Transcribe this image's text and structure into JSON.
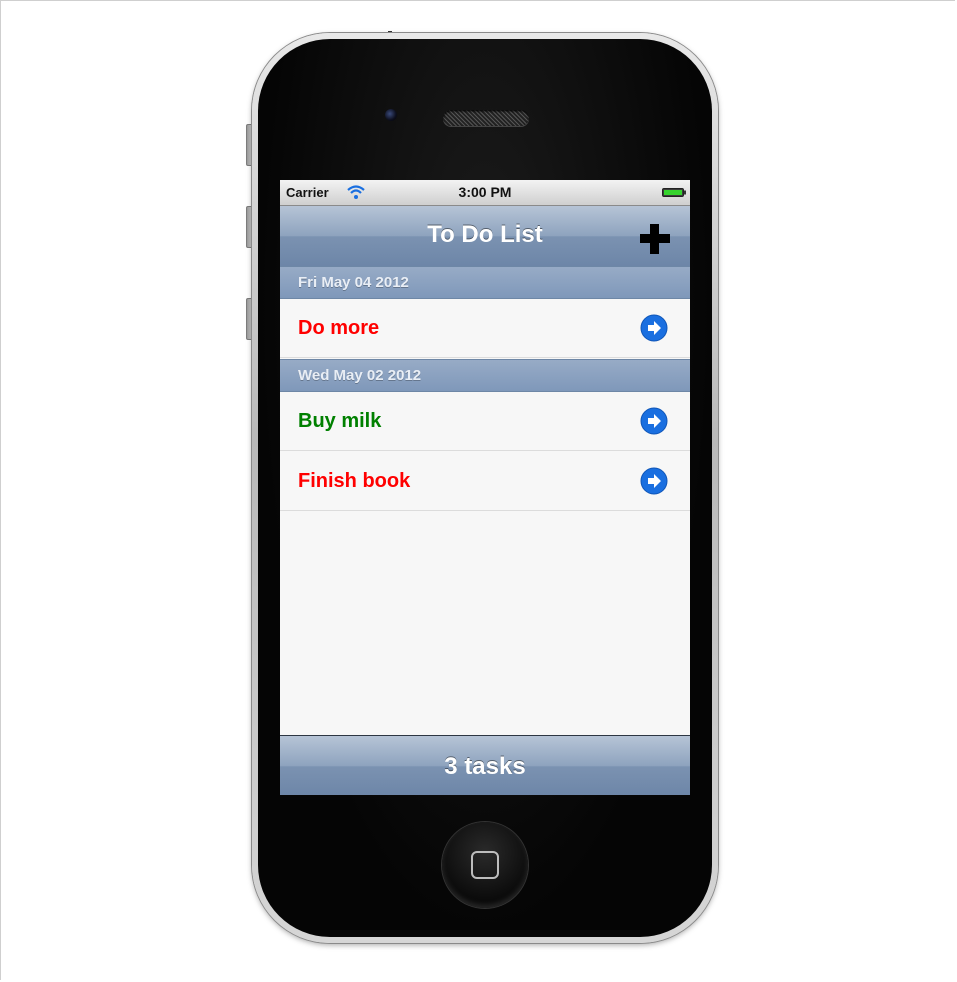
{
  "status_bar": {
    "carrier": "Carrier",
    "time": "3:00 PM",
    "wifi_icon": "wifi-icon",
    "battery_icon": "battery-icon"
  },
  "nav": {
    "title": "To Do List",
    "add_icon": "plus-icon"
  },
  "sections": [
    {
      "header": "Fri May 04 2012",
      "rows": [
        {
          "label": "Do more",
          "color": "#ff0000",
          "accessory": "chevron-right-circle-icon"
        }
      ]
    },
    {
      "header": "Wed May 02 2012",
      "rows": [
        {
          "label": "Buy milk",
          "color": "#008000",
          "accessory": "chevron-right-circle-icon"
        },
        {
          "label": "Finish book",
          "color": "#ff0000",
          "accessory": "chevron-right-circle-icon"
        }
      ]
    }
  ],
  "toolbar": {
    "label": "3 tasks"
  },
  "colors": {
    "nav_bar": "#7b92b1",
    "section_header": "#8aa1c0",
    "accessory_blue": "#1a6fe0"
  }
}
